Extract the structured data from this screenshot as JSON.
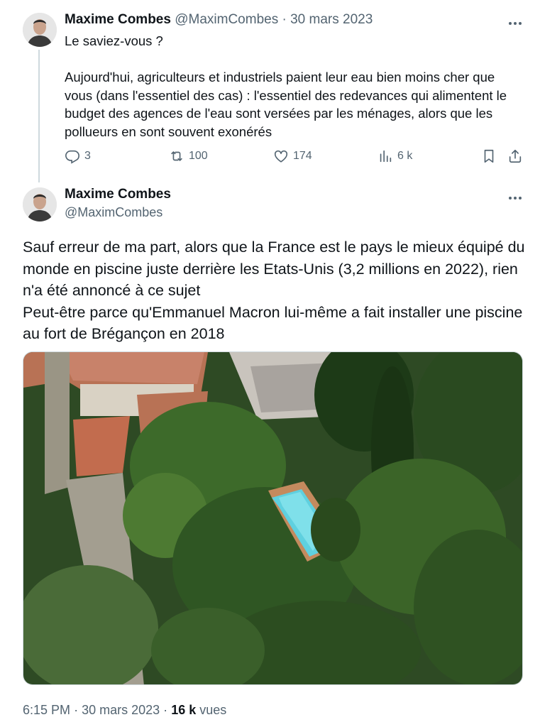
{
  "tweet1": {
    "author_name": "Maxime Combes",
    "author_handle": "@MaximCombes",
    "date": "30 mars 2023",
    "separator": "·",
    "text_line1": "Le saviez-vous ?",
    "text_para2": "Aujourd'hui, agriculteurs et industriels paient leur eau bien moins cher que vous (dans l'essentiel des cas) : l'essentiel des redevances qui alimentent le budget des agences de l'eau sont versées par les ménages, alors que les pollueurs en sont souvent exonérés",
    "replies": "3",
    "retweets": "100",
    "likes": "174",
    "views": "6 k"
  },
  "tweet2": {
    "author_name": "Maxime Combes",
    "author_handle": "@MaximCombes",
    "text_para1": "Sauf erreur de ma part, alors que la France est le pays le mieux équipé du monde en piscine juste derrière les Etats-Unis (3,2 millions en 2022), rien n'a été annoncé à ce sujet",
    "text_para2": "Peut-être parce qu'Emmanuel Macron lui-même a fait installer une piscine au fort de Brégançon en 2018",
    "time": "6:15 PM",
    "date": "30 mars 2023",
    "separator": "·",
    "views_count": "16 k",
    "views_label": "vues"
  },
  "icons": {
    "more": "more-horizontal-icon",
    "reply": "reply-icon",
    "retweet": "retweet-icon",
    "like": "heart-icon",
    "views": "views-bar-chart-icon",
    "bookmark": "bookmark-icon",
    "share": "share-icon"
  },
  "colors": {
    "text": "#0f1419",
    "muted": "#536471",
    "thread_line": "#cfd9de"
  }
}
